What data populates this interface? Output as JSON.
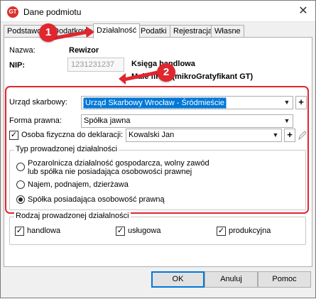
{
  "window": {
    "title": "Dane podmiotu",
    "app_icon_text": "GT"
  },
  "tabs": [
    {
      "label": "Podstawowe"
    },
    {
      "label": "Dodatkowe"
    },
    {
      "label": "Działalność"
    },
    {
      "label": "Podatki"
    },
    {
      "label": "Rejestracja"
    },
    {
      "label": "Własne"
    }
  ],
  "header": {
    "name_label": "Nazwa:",
    "name_value": "Rewizor",
    "nip_label": "NIP:",
    "nip_value": "1231231237",
    "ledger_line1": "Księga handlowa",
    "ledger_line2": "Małe firmy (mikroGratyfikant GT)"
  },
  "form": {
    "tax_office_label": "Urząd skarbowy:",
    "tax_office_value": "Urząd Skarbowy Wrocław - Śródmieście",
    "legal_form_label": "Forma prawna:",
    "legal_form_value": "Spółka jawna",
    "declaration_person_label": "Osoba fizyczna do deklaracji:",
    "declaration_person_checked": true,
    "declaration_person_value": "Kowalski Jan"
  },
  "activity_type": {
    "title": "Typ prowadzonej działalności",
    "options": [
      {
        "label_line1": "Pozarolnicza działalność gospodarcza, wolny zawód",
        "label_line2": "lub spółka nie posiadająca osobowości prawnej",
        "selected": false
      },
      {
        "label_line1": "Najem, podnajem, dzierżawa",
        "label_line2": "",
        "selected": false
      },
      {
        "label_line1": "Spółka posiadająca osobowość prawną",
        "label_line2": "",
        "selected": true
      }
    ]
  },
  "activity_kind": {
    "title": "Rodzaj prowadzonej działalności",
    "options": [
      {
        "label": "handlowa",
        "checked": true
      },
      {
        "label": "usługowa",
        "checked": true
      },
      {
        "label": "produkcyjna",
        "checked": true
      }
    ]
  },
  "buttons": {
    "ok": "OK",
    "cancel": "Anuluj",
    "help": "Pomoc"
  },
  "annotations": {
    "step1": "1",
    "step2": "2"
  },
  "colors": {
    "accent_red": "#e0262e",
    "selection_blue": "#0078d7"
  }
}
